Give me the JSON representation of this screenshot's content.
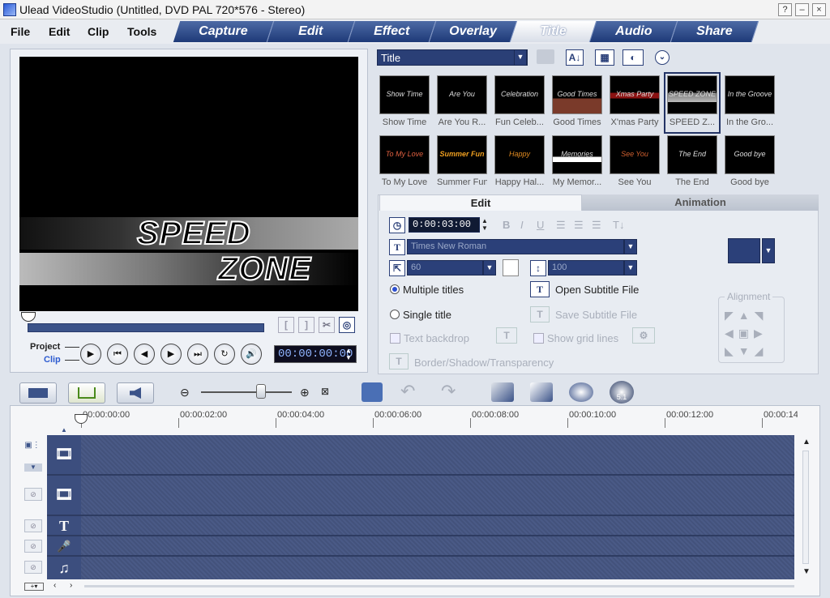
{
  "window": {
    "title": "Ulead VideoStudio (Untitled, DVD PAL 720*576 - Stereo)",
    "help": "?",
    "minimize": "–",
    "close": "×"
  },
  "menu": [
    "File",
    "Edit",
    "Clip",
    "Tools"
  ],
  "steps": [
    {
      "label": "Capture",
      "active": false
    },
    {
      "label": "Edit",
      "active": false
    },
    {
      "label": "Effect",
      "active": false
    },
    {
      "label": "Overlay",
      "active": false
    },
    {
      "label": "Title",
      "active": true
    },
    {
      "label": "Audio",
      "active": false
    },
    {
      "label": "Share",
      "active": false
    }
  ],
  "preview": {
    "title_line1": "SPEED",
    "title_line2": "ZONE",
    "mode_project": "Project",
    "mode_clip": "Clip",
    "timecode": "00:00:00:00",
    "mark_in": "[",
    "mark_out": "]"
  },
  "library": {
    "category": "Title",
    "thumbnails": [
      {
        "label": "Show Time",
        "art": "Show Time",
        "selected": false
      },
      {
        "label": "Are You R...",
        "art": "Are You Ready?",
        "selected": false
      },
      {
        "label": "Fun Celeb...",
        "art": "Celebration",
        "selected": false
      },
      {
        "label": "Good Times",
        "art": "Good Times",
        "selected": false
      },
      {
        "label": "X'mas Party",
        "art": "Xmas Party",
        "selected": false
      },
      {
        "label": "SPEED Z...",
        "art": "SPEED ZONE",
        "selected": true
      },
      {
        "label": "In the Gro...",
        "art": "In the Groove",
        "selected": false
      },
      {
        "label": "To My Love",
        "art": "To My Love",
        "selected": false
      },
      {
        "label": "Summer Fun",
        "art": "Summer Fun",
        "selected": false
      },
      {
        "label": "Happy Hal...",
        "art": "Happy Halloween",
        "selected": false
      },
      {
        "label": "My Memor...",
        "art": "Memories",
        "selected": false
      },
      {
        "label": "See You",
        "art": "See You",
        "selected": false
      },
      {
        "label": "The End",
        "art": "The End",
        "selected": false
      },
      {
        "label": "Good bye",
        "art": "Good bye",
        "selected": false
      }
    ]
  },
  "options": {
    "tab_edit": "Edit",
    "tab_animation": "Animation",
    "duration": "0:00:03:00",
    "font": "Times New Roman",
    "font_size": "60",
    "line_spacing": "100",
    "multiple_titles": "Multiple titles",
    "single_title": "Single title",
    "open_subtitle": "Open Subtitle File",
    "save_subtitle": "Save Subtitle File",
    "text_backdrop": "Text backdrop",
    "show_grid": "Show grid lines",
    "border_shadow": "Border/Shadow/Transparency",
    "alignment": "Alignment",
    "bold": "B",
    "italic": "I",
    "underline": "U"
  },
  "timeline": {
    "ticks": [
      "00:00:00:00",
      "00:00:02:00",
      "00:00:04:00",
      "00:00:06:00",
      "00:00:08:00",
      "00:00:10:00",
      "00:00:12:00",
      "00:00:14"
    ]
  },
  "colors": {
    "accent": "#2b4079",
    "track": "#4a5a86",
    "tab": "#1e3a78"
  }
}
